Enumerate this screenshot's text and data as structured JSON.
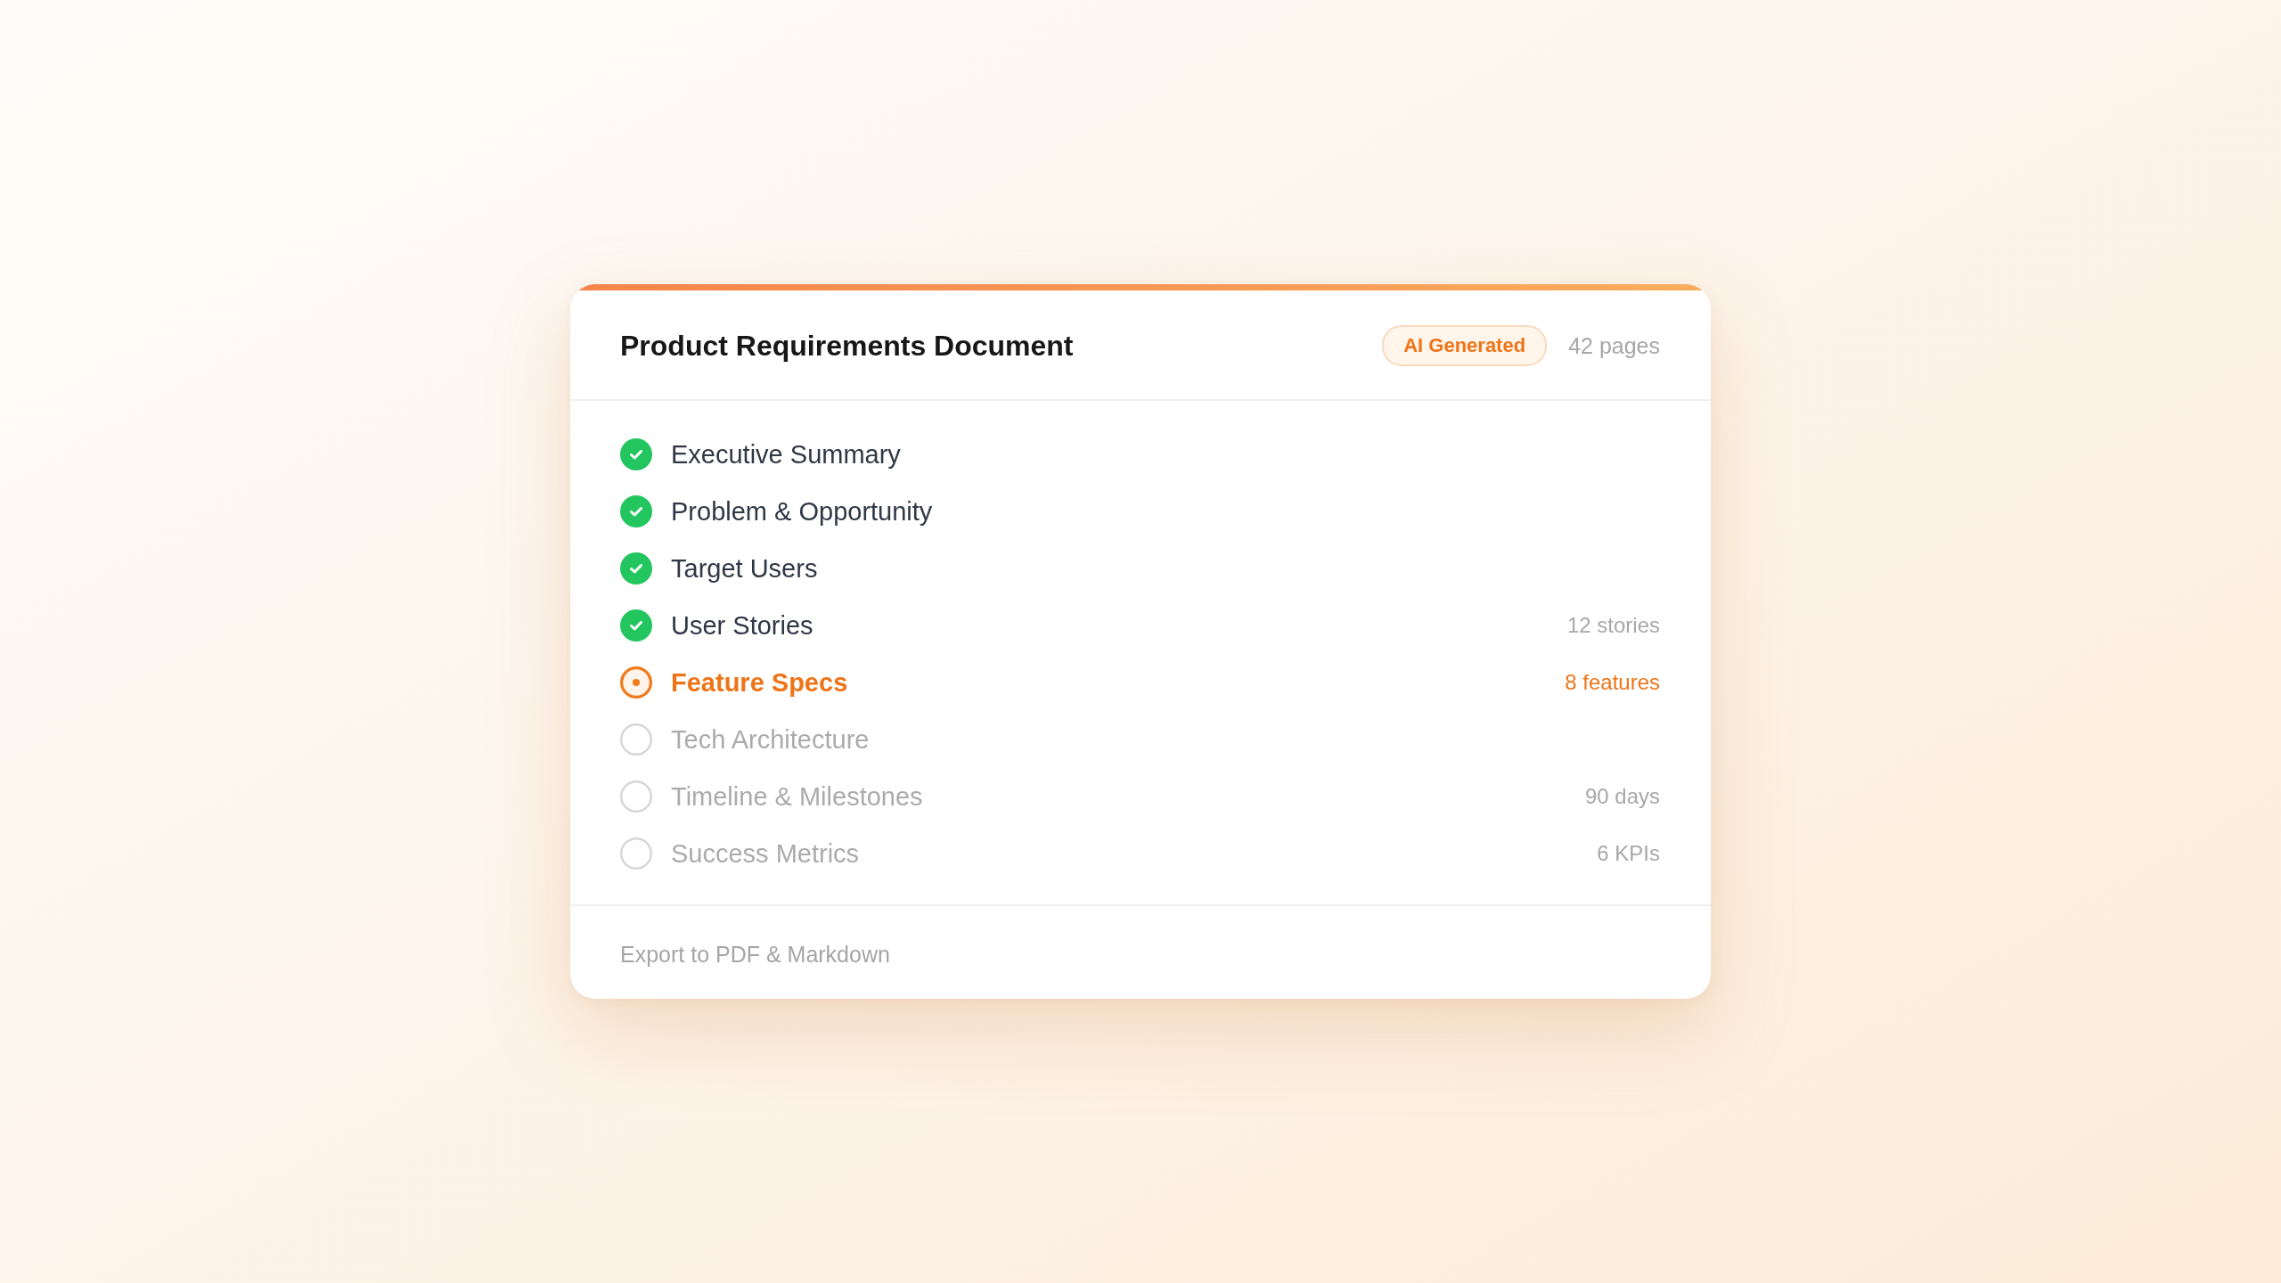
{
  "document": {
    "title": "Product Requirements Document",
    "badge": "AI Generated",
    "page_count": "42 pages"
  },
  "sections": [
    {
      "label": "Executive Summary",
      "kind": "done"
    },
    {
      "label": "Problem & Opportunity",
      "kind": "done"
    },
    {
      "label": "Target Users",
      "kind": "done"
    },
    {
      "label": "User Stories",
      "kind": "done",
      "meta": "12 stories"
    },
    {
      "label": "Feature Specs",
      "kind": "active",
      "meta": "8 features"
    },
    {
      "label": "Tech Architecture",
      "kind": "pending"
    },
    {
      "label": "Timeline & Milestones",
      "kind": "pending",
      "meta": "90 days"
    },
    {
      "label": "Success Metrics",
      "kind": "pending",
      "meta": "6 KPIs"
    }
  ],
  "footer": {
    "note": "Export to PDF & Markdown"
  }
}
